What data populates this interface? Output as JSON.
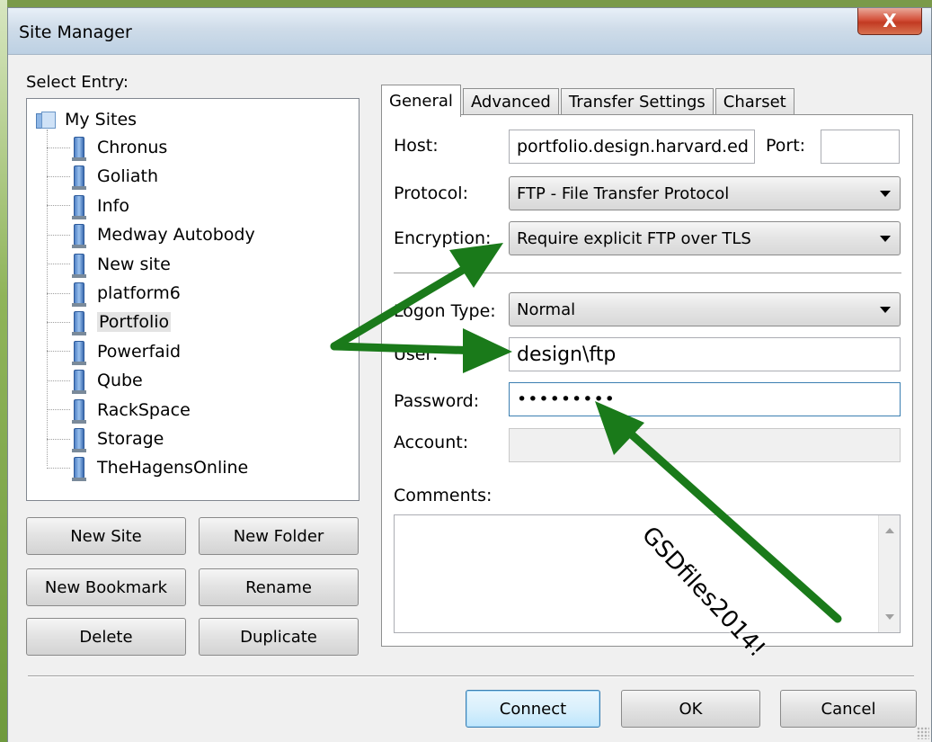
{
  "window": {
    "title": "Site Manager",
    "close_glyph": "X"
  },
  "entries": {
    "label": "Select Entry:",
    "root": "My Sites",
    "sites": [
      "Chronus",
      "Goliath",
      "Info",
      "Medway Autobody",
      "New site",
      "platform6",
      "Portfolio",
      "Powerfaid",
      "Qube",
      "RackSpace",
      "Storage",
      "TheHagensOnline"
    ],
    "selected": "Portfolio"
  },
  "left_buttons": {
    "new_site": "New Site",
    "new_folder": "New Folder",
    "new_bookmark": "New Bookmark",
    "rename": "Rename",
    "delete": "Delete",
    "duplicate": "Duplicate"
  },
  "tabs": [
    {
      "label": "General",
      "active": true
    },
    {
      "label": "Advanced",
      "active": false
    },
    {
      "label": "Transfer Settings",
      "active": false
    },
    {
      "label": "Charset",
      "active": false
    }
  ],
  "general": {
    "host_label": "Host:",
    "host_value": "portfolio.design.harvard.ed",
    "port_label": "Port:",
    "port_value": "",
    "protocol_label": "Protocol:",
    "protocol_value": "FTP - File Transfer Protocol",
    "encryption_label": "Encryption:",
    "encryption_value": "Require explicit FTP over TLS",
    "logon_label": "Logon Type:",
    "logon_value": "Normal",
    "user_label": "User:",
    "user_value": "design\\ftp",
    "password_label": "Password:",
    "password_value": "•••••••••",
    "account_label": "Account:",
    "account_value": "",
    "comments_label": "Comments:",
    "comments_value": ""
  },
  "footer_buttons": {
    "connect": "Connect",
    "ok": "OK",
    "cancel": "Cancel"
  },
  "annotation": {
    "text": "GSDfiles2014!",
    "arrow_color": "#1a7a1a"
  },
  "colors": {
    "accent_green": "#1a7a1a",
    "title_bar": "#cfdce9",
    "close_red": "#c23a22"
  }
}
